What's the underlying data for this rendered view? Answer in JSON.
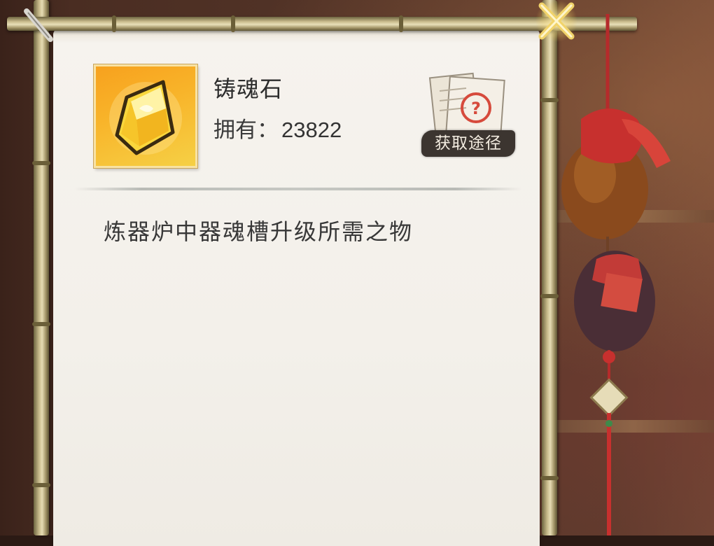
{
  "item": {
    "name": "铸魂石",
    "owned_label": "拥有：",
    "owned_count": "23822",
    "description": "炼器炉中器魂槽升级所需之物"
  },
  "actions": {
    "source_label": "获取途径"
  },
  "icons": {
    "item": "golden-crystal-icon",
    "source": "help-scroll-icon",
    "close": "close-x-icon",
    "decoration": "hanging-gourd-ornament"
  },
  "colors": {
    "icon_bg": "#f8b329",
    "paper": "#f5f2ed",
    "text": "#333333",
    "label_bg": "#3c3530"
  }
}
